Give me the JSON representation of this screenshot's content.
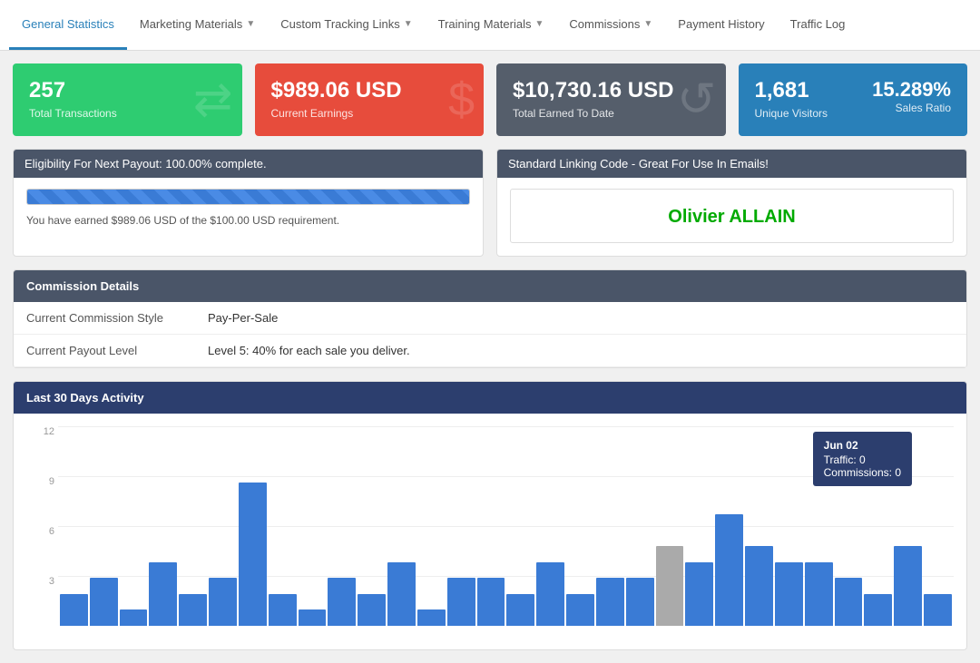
{
  "nav": {
    "items": [
      {
        "label": "General Statistics",
        "active": true,
        "hasArrow": false
      },
      {
        "label": "Marketing Materials",
        "active": false,
        "hasArrow": true
      },
      {
        "label": "Custom Tracking Links",
        "active": false,
        "hasArrow": true
      },
      {
        "label": "Training Materials",
        "active": false,
        "hasArrow": true
      },
      {
        "label": "Commissions",
        "active": false,
        "hasArrow": true
      },
      {
        "label": "Payment History",
        "active": false,
        "hasArrow": false
      },
      {
        "label": "Traffic Log",
        "active": false,
        "hasArrow": false
      }
    ]
  },
  "stats": {
    "transactions": {
      "value": "257",
      "label": "Total Transactions"
    },
    "earnings": {
      "value": "$989.06 USD",
      "label": "Current Earnings"
    },
    "total_earned": {
      "value": "$10,730.16 USD",
      "label": "Total Earned To Date"
    },
    "visitors": {
      "value": "1,681",
      "label": "Unique Visitors"
    },
    "sales_ratio": {
      "value": "15.289%",
      "label": "Sales Ratio"
    }
  },
  "payout": {
    "title": "Eligibility For Next Payout: 100.00% complete.",
    "description": "You have earned $989.06 USD of the $100.00 USD requirement."
  },
  "linking": {
    "title": "Standard Linking Code - Great For Use In Emails!",
    "name": "Olivier ALLAIN"
  },
  "commission": {
    "header": "Commission Details",
    "rows": [
      {
        "label": "Current Commission Style",
        "value": "Pay-Per-Sale"
      },
      {
        "label": "Current Payout Level",
        "value": "Level 5: 40% for each sale you deliver."
      }
    ]
  },
  "chart": {
    "header": "Last 30 Days Activity",
    "y_labels": [
      "12",
      "9",
      "6",
      "3"
    ],
    "tooltip": {
      "date": "Jun 02",
      "traffic": "Traffic: 0",
      "commissions": "Commissions: 0"
    },
    "bars": [
      2,
      3,
      1,
      4,
      2,
      3,
      9,
      2,
      1,
      3,
      2,
      4,
      1,
      3,
      3,
      2,
      4,
      2,
      3,
      3,
      5,
      4,
      7,
      5,
      4,
      4,
      3,
      2,
      5,
      2
    ],
    "gray_bar_index": 20
  }
}
